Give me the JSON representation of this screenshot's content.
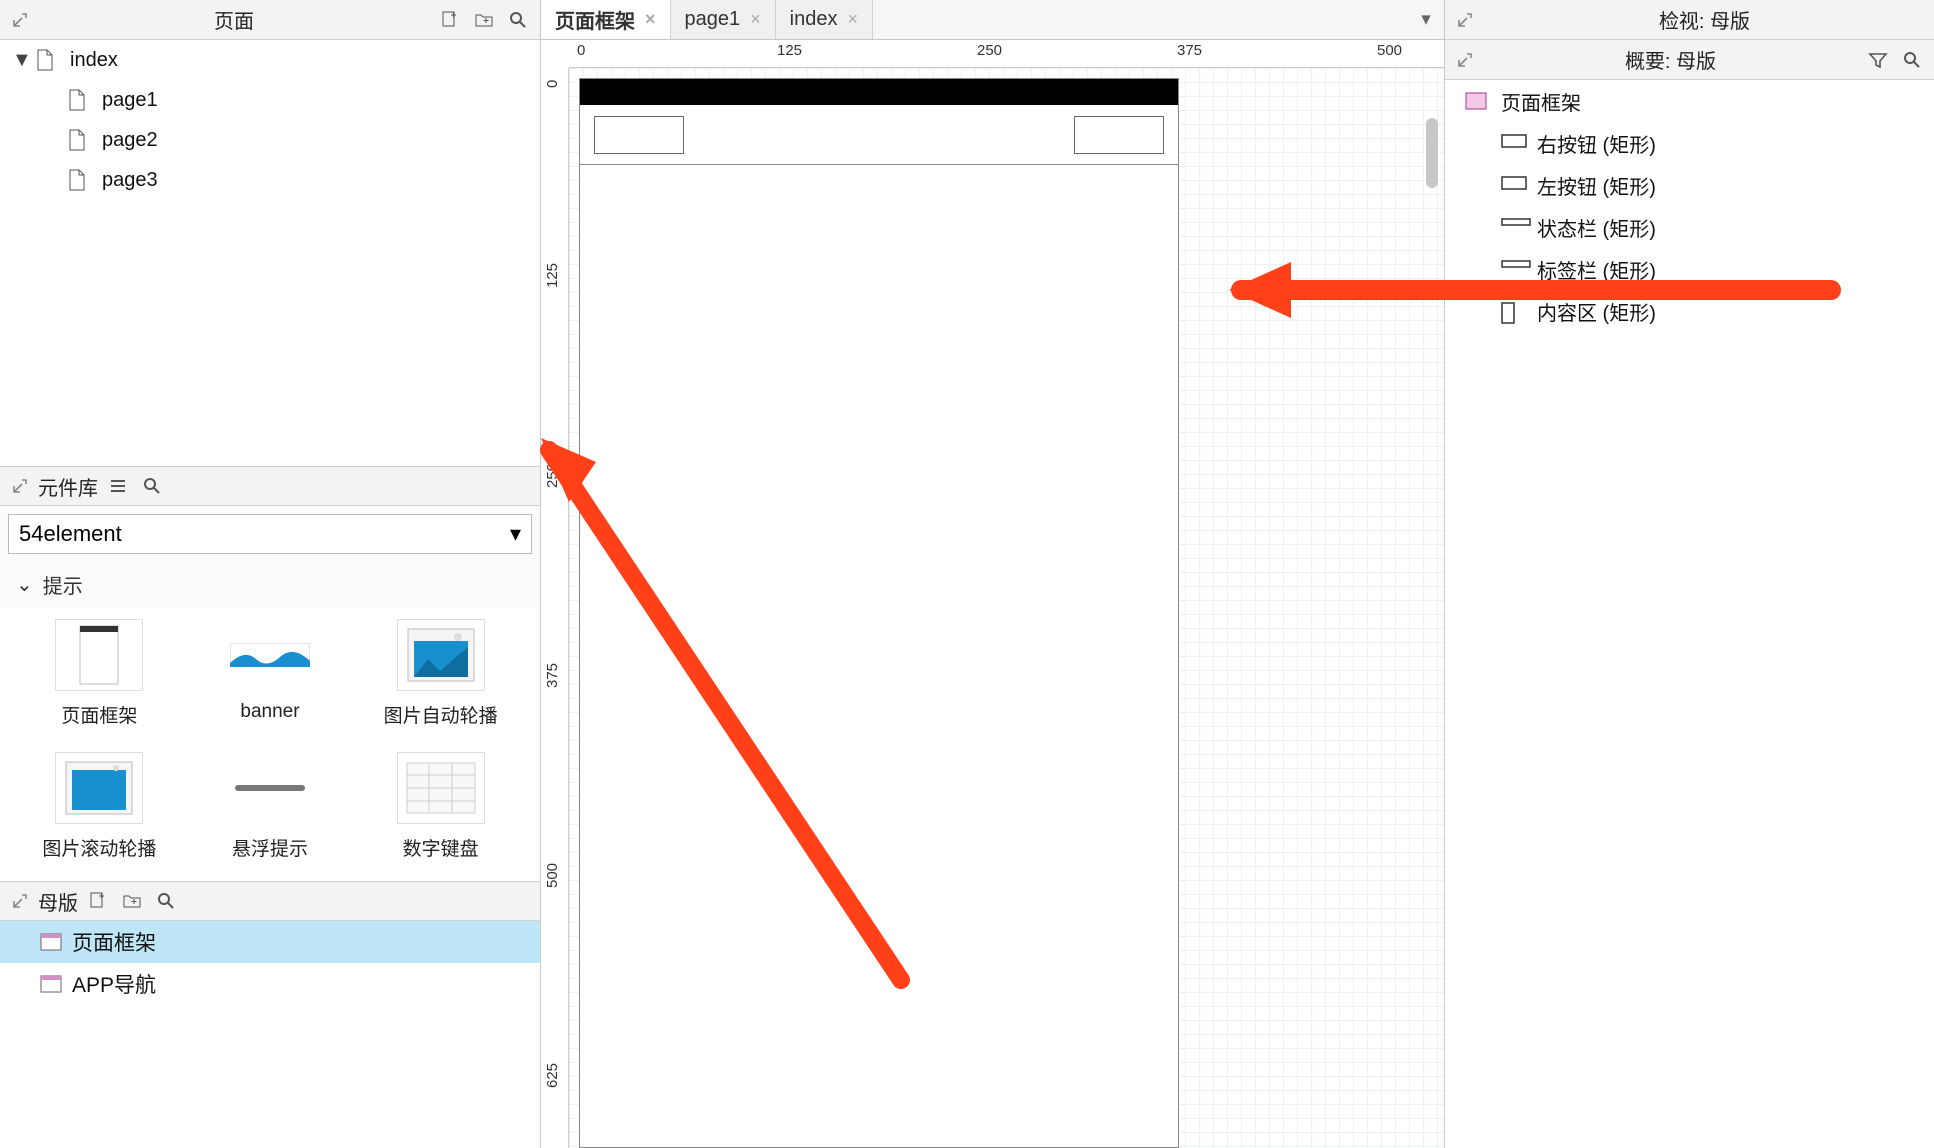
{
  "pages_panel": {
    "title": "页面",
    "tree": [
      {
        "type": "folder",
        "label": "index",
        "expanded": true
      },
      {
        "type": "page",
        "label": "page1"
      },
      {
        "type": "page",
        "label": "page2"
      },
      {
        "type": "page",
        "label": "page3"
      }
    ]
  },
  "library_panel": {
    "title": "元件库",
    "selected_library": "54element",
    "category": "提示",
    "widgets": [
      {
        "label": "页面框架"
      },
      {
        "label": "banner"
      },
      {
        "label": "图片自动轮播"
      },
      {
        "label": "图片滚动轮播"
      },
      {
        "label": "悬浮提示"
      },
      {
        "label": "数字键盘"
      }
    ]
  },
  "masters_panel": {
    "title": "母版",
    "items": [
      {
        "label": "页面框架",
        "selected": true
      },
      {
        "label": "APP导航",
        "selected": false
      }
    ]
  },
  "tabs": [
    {
      "label": "页面框架",
      "active": true
    },
    {
      "label": "page1",
      "active": false
    },
    {
      "label": "index",
      "active": false
    }
  ],
  "ruler_ticks": [
    "0",
    "125",
    "250",
    "375",
    "500"
  ],
  "ruler_ticks_v": [
    "0",
    "125",
    "250",
    "375",
    "500",
    "625"
  ],
  "inspect_panel": {
    "title": "检视: 母版"
  },
  "outline_panel": {
    "title": "概要: 母版",
    "root": "页面框架",
    "children": [
      "右按钮 (矩形)",
      "左按钮 (矩形)",
      "状态栏 (矩形)",
      "标签栏 (矩形)",
      "内容区 (矩形)"
    ]
  }
}
